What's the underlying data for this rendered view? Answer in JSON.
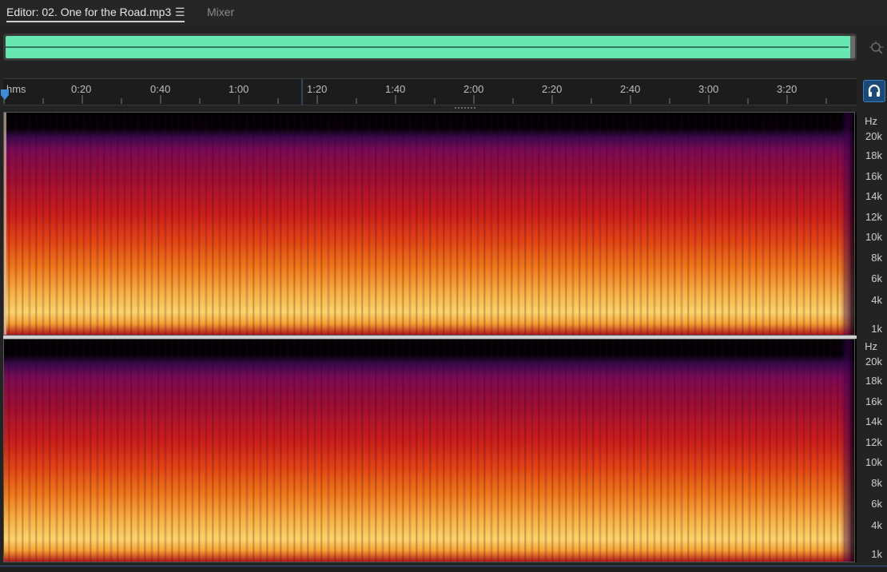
{
  "tabs": {
    "editor_label": "Editor: 02. One for the Road.mp3",
    "menu_glyph": "☰",
    "mixer_label": "Mixer"
  },
  "colors": {
    "overview_wave": "#66e8b0",
    "accent_blue": "#1a4a78"
  },
  "icons": {
    "zoom": "zoom-navigator-icon",
    "channel": "headphones-icon",
    "playhead": "playhead-icon"
  },
  "ruler": {
    "unit": "hms",
    "labels": [
      "0:20",
      "0:40",
      "1:00",
      "1:20",
      "1:40",
      "2:00",
      "2:20",
      "2:40",
      "3:00",
      "3:20"
    ]
  },
  "frequency_axis": {
    "unit": "Hz",
    "labels": [
      "20k",
      "18k",
      "16k",
      "14k",
      "12k",
      "10k",
      "8k",
      "6k",
      "4k",
      "1k"
    ]
  }
}
